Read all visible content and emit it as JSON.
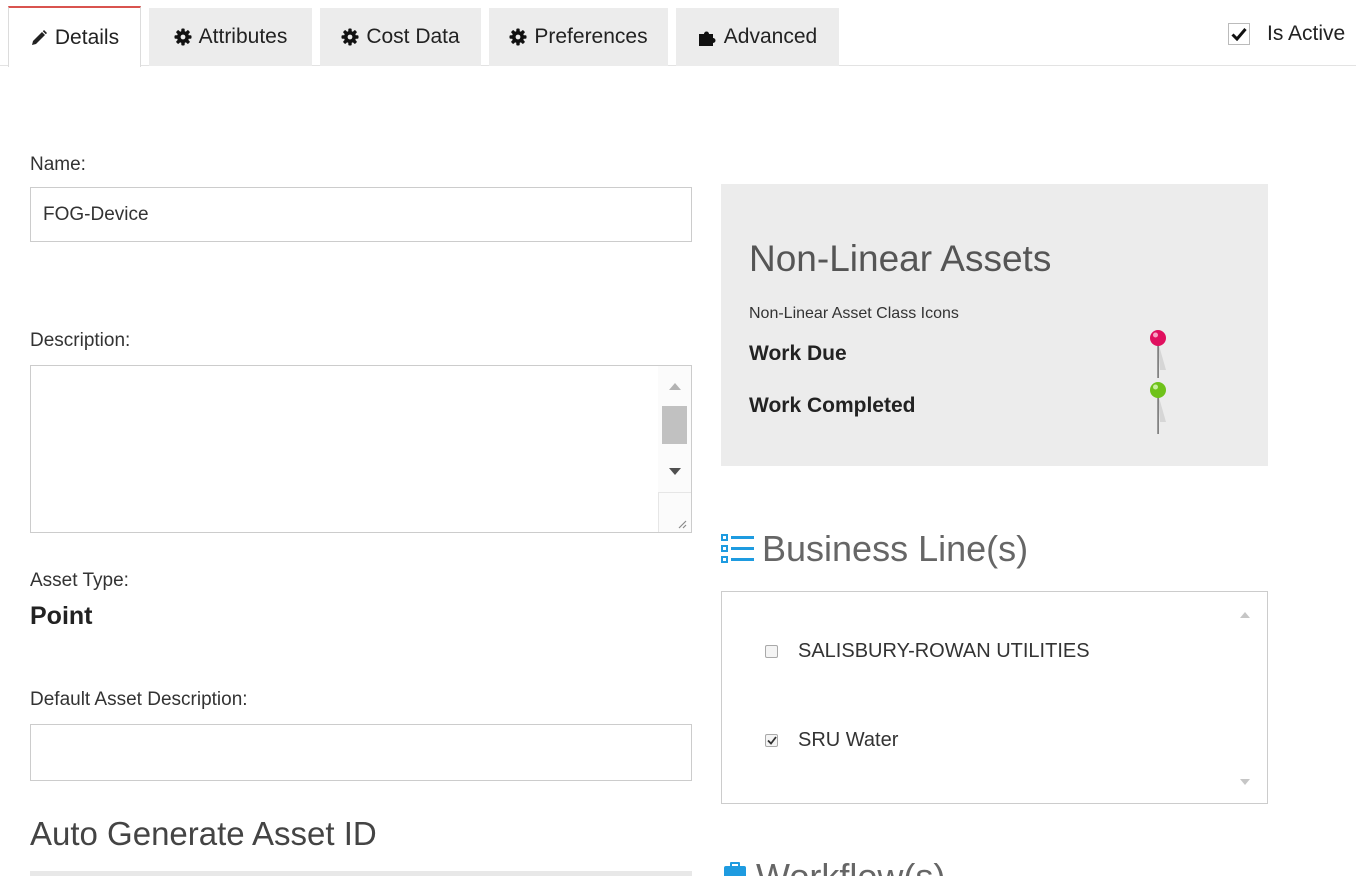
{
  "tabs": {
    "details": "Details",
    "attributes": "Attributes",
    "cost_data": "Cost Data",
    "preferences": "Preferences",
    "advanced": "Advanced"
  },
  "is_active": {
    "label": "Is Active",
    "checked": true
  },
  "form": {
    "name_label": "Name:",
    "name_value": "FOG-Device",
    "description_label": "Description:",
    "description_value": "",
    "asset_type_label": "Asset Type:",
    "asset_type_value": "Point",
    "default_desc_label": "Default Asset Description:",
    "default_desc_value": "",
    "auto_generate_heading": "Auto Generate Asset ID"
  },
  "non_linear": {
    "title": "Non-Linear Assets",
    "subtitle": "Non-Linear Asset Class Icons",
    "work_due": "Work Due",
    "work_completed": "Work Completed",
    "colors": {
      "due_pin": "#e0105f",
      "completed_pin": "#6fc21a"
    }
  },
  "business_lines": {
    "heading": "Business Line(s)",
    "items": [
      {
        "label": "SALISBURY-ROWAN UTILITIES",
        "checked": false
      },
      {
        "label": "SRU Water",
        "checked": true
      }
    ]
  },
  "workflows": {
    "heading": "Workflow(s)"
  },
  "colors": {
    "active_tab_accent": "#d9534f",
    "icon_blue": "#1e9be0"
  }
}
